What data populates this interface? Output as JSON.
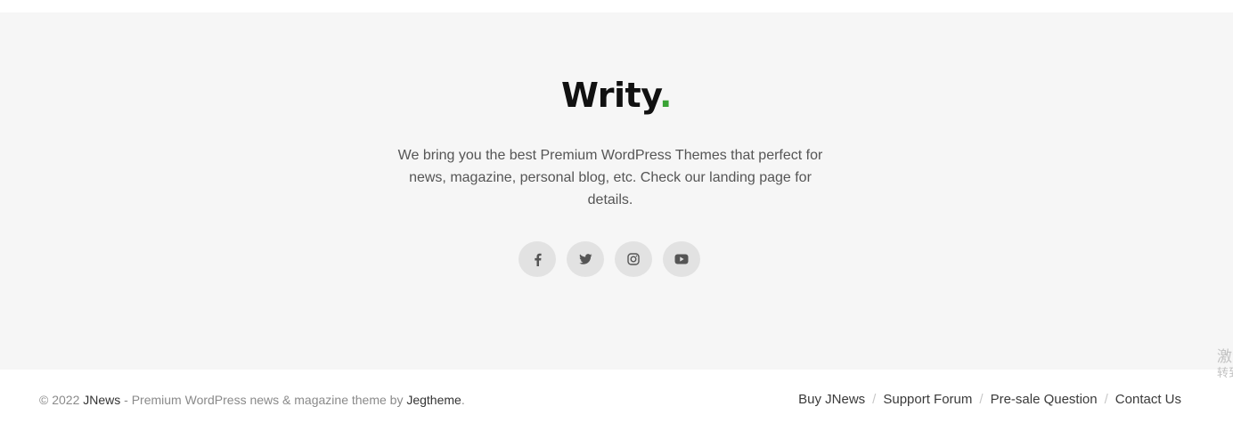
{
  "footer": {
    "logo_text": "Writy",
    "logo_dot": ".",
    "logo_dot_color": "#3aa335",
    "about": "We bring you the best Premium WordPress Themes that perfect for news, magazine, personal blog, etc. Check our landing page for details.",
    "socials": [
      {
        "icon": "facebook-icon"
      },
      {
        "icon": "twitter-icon"
      },
      {
        "icon": "instagram-icon"
      },
      {
        "icon": "youtube-icon"
      }
    ]
  },
  "bottom_bar": {
    "copyright_prefix": "© 2022 ",
    "brand_link": "JNews",
    "copyright_middle": " - Premium WordPress news & magazine theme by ",
    "author_link": "Jegtheme",
    "copyright_suffix": ".",
    "nav": [
      "Buy JNews",
      "Support Forum",
      "Pre-sale Question",
      "Contact Us"
    ],
    "separator": "/"
  },
  "overlay": {
    "line1": "激活",
    "line2": "转到"
  }
}
